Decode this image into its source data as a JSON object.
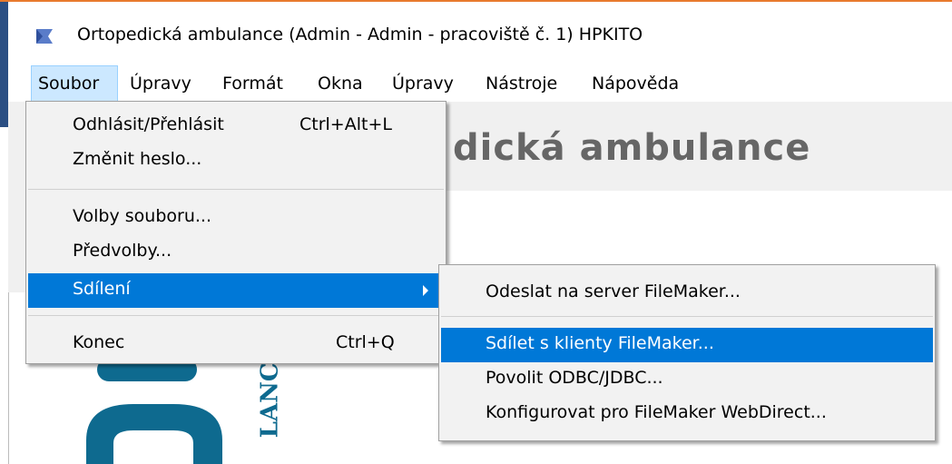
{
  "window": {
    "title": "Ortopedická ambulance (Admin - Admin - pracoviště č. 1) HPKITO"
  },
  "menubar": {
    "items": [
      {
        "label": "Soubor"
      },
      {
        "label": "Úpravy"
      },
      {
        "label": "Formát"
      },
      {
        "label": "Okna"
      },
      {
        "label": "Úpravy"
      },
      {
        "label": "Nástroje"
      },
      {
        "label": "Nápověda"
      }
    ]
  },
  "file_menu": {
    "items": [
      {
        "label": "Odhlásit/Přehlásit",
        "shortcut": "Ctrl+Alt+L"
      },
      {
        "label": "Změnit heslo..."
      },
      {
        "label": "Volby souboru..."
      },
      {
        "label": "Předvolby..."
      },
      {
        "label": "Sdílení",
        "has_submenu": true,
        "selected": true
      },
      {
        "label": "Konec",
        "shortcut": "Ctrl+Q"
      }
    ]
  },
  "sharing_submenu": {
    "items": [
      {
        "label": "Odeslat na server FileMaker..."
      },
      {
        "label": "Sdílet s klienty FileMaker...",
        "selected": true
      },
      {
        "label": "Povolit ODBC/JDBC..."
      },
      {
        "label": "Konfigurovat pro FileMaker WebDirect..."
      }
    ]
  },
  "content": {
    "header_visible": "dická ambulance",
    "logo_text": "LANCE"
  },
  "colors": {
    "selection": "#0078d7",
    "menu_bg": "#f2f2f2",
    "active_menu_bg": "#cce8ff",
    "header_text": "#666666",
    "logo": "#0e6a8f",
    "top_border": "#e87a2e"
  }
}
